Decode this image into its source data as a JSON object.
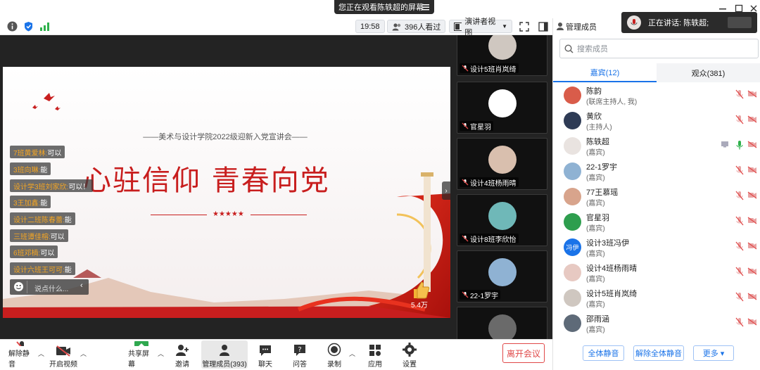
{
  "window": {
    "share_banner": "您正在观看陈轶超的屏幕",
    "speaking_now": "正在讲话: 陈轶超;"
  },
  "infobar": {
    "time": "19:58",
    "viewers": "396人看过",
    "view_mode": "演讲者视图"
  },
  "slide": {
    "subtitle": "——美术与设计学院2022级迎新入党宣讲会——",
    "title": "心驻信仰  青春向党",
    "stars": "★★★★★",
    "like_count": "5.4万"
  },
  "chat": {
    "messages": [
      {
        "name": "7班黄爱林:",
        "text": " 可以"
      },
      {
        "name": "3班向琳:",
        "text": " 能"
      },
      {
        "name": "设计学3班刘家欣:",
        "text": " 可以！"
      },
      {
        "name": "3王加鑫:",
        "text": " 能"
      },
      {
        "name": "设计二班陈春蕾:",
        "text": " 能"
      },
      {
        "name": "三班谭佳榕:",
        "text": " 可以"
      },
      {
        "name": "6班邓楠:",
        "text": " 可以"
      },
      {
        "name": "设计六班王可可:",
        "text": " 能"
      }
    ],
    "input_placeholder": "说点什么..."
  },
  "thumbnails": [
    {
      "name": "设计5班肖岚绮",
      "color": "#cfc7c0"
    },
    {
      "name": "官星羽",
      "color": "#ffffff"
    },
    {
      "name": "设计4班杨雨晴",
      "color": "#d9bfae"
    },
    {
      "name": "设计8班李欣怡",
      "color": "#6fb8b8"
    },
    {
      "name": "22-1罗宇",
      "color": "#8fb2d3"
    },
    {
      "name": "",
      "color": "#6a6a6a"
    }
  ],
  "toolbar": {
    "unmute": "解除静音",
    "start_video": "开启视频",
    "share_screen": "共享屏幕",
    "invite": "邀请",
    "manage": "管理成员(393)",
    "chat": "聊天",
    "qa": "问答",
    "record": "录制",
    "apps": "应用",
    "settings": "设置",
    "leave": "离开会议"
  },
  "panel": {
    "title": "管理成员",
    "search_placeholder": "搜索成员",
    "tab_guests": "嘉宾(12)",
    "tab_audience": "观众(381)",
    "members": [
      {
        "name": "陈韵",
        "role": "(联席主持人, 我)",
        "avatar_color": "#d95c4a",
        "avatar_text": ""
      },
      {
        "name": "黄欣",
        "role": "(主持人)",
        "avatar_color": "#2e3b55",
        "avatar_text": ""
      },
      {
        "name": "陈轶超",
        "role": "(嘉宾)",
        "avatar_color": "#e9e3e0",
        "avatar_text": ""
      },
      {
        "name": "22-1罗宇",
        "role": "(嘉宾)",
        "avatar_color": "#8fb2d3",
        "avatar_text": ""
      },
      {
        "name": "77王慕瑶",
        "role": "(嘉宾)",
        "avatar_color": "#d8a48c",
        "avatar_text": ""
      },
      {
        "name": "官星羽",
        "role": "(嘉宾)",
        "avatar_color": "#2e9e4e",
        "avatar_text": ""
      },
      {
        "name": "设计3班冯伊",
        "role": "(嘉宾)",
        "avatar_color": "#1a73e8",
        "avatar_text": "冯伊"
      },
      {
        "name": "设计4班杨雨晴",
        "role": "(嘉宾)",
        "avatar_color": "#e7c9c2",
        "avatar_text": ""
      },
      {
        "name": "设计5班肖岚绮",
        "role": "(嘉宾)",
        "avatar_color": "#cfc7c0",
        "avatar_text": ""
      },
      {
        "name": "邵雨涵",
        "role": "(嘉宾)",
        "avatar_color": "#5e6a78",
        "avatar_text": ""
      }
    ],
    "mute_all": "全体静音",
    "unmute_all": "解除全体静音",
    "more": "更多 ▾"
  },
  "colors": {
    "accent": "#1a73e8",
    "danger": "#e04848",
    "party_red": "#c81e1e"
  }
}
